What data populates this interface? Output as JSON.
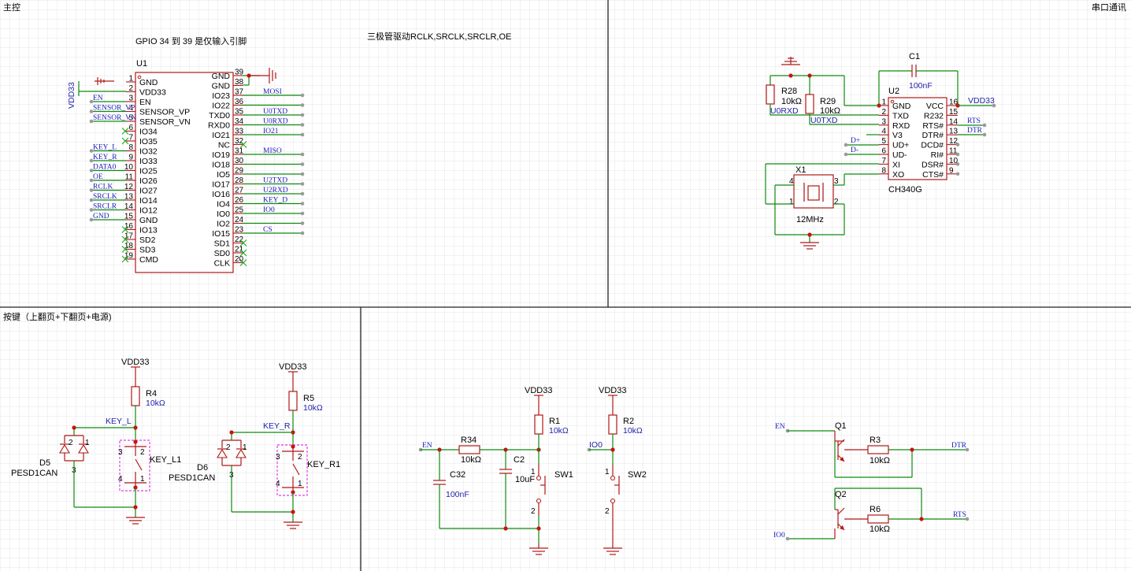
{
  "sections": {
    "main": "主控",
    "serial": "串口通讯",
    "keys": "按键（上翻页+下翻页+电源)"
  },
  "notes": {
    "gpio_note": "GPIO 34 到 39 是仅输入引脚",
    "transistor_note": "三极管驱动RCLK,SRCLK,SRCLR,OE"
  },
  "u1": {
    "ref": "U1",
    "power_label": "VDD33",
    "left_pins": [
      {
        "num": "1",
        "name": "GND",
        "net": ""
      },
      {
        "num": "2",
        "name": "VDD33",
        "net": ""
      },
      {
        "num": "3",
        "name": "EN",
        "net": "EN"
      },
      {
        "num": "4",
        "name": "SENSOR_VP",
        "net": "SENSOR_VP"
      },
      {
        "num": "5",
        "name": "SENSOR_VN",
        "net": "SENSOR_VN"
      },
      {
        "num": "6",
        "name": "IO34",
        "net": ""
      },
      {
        "num": "7",
        "name": "IO35",
        "net": ""
      },
      {
        "num": "8",
        "name": "IO32",
        "net": "KEY_L"
      },
      {
        "num": "9",
        "name": "IO33",
        "net": "KEY_R"
      },
      {
        "num": "10",
        "name": "IO25",
        "net": "DATA0"
      },
      {
        "num": "11",
        "name": "IO26",
        "net": "OE"
      },
      {
        "num": "12",
        "name": "IO27",
        "net": "RCLK"
      },
      {
        "num": "13",
        "name": "IO14",
        "net": "SRCLK"
      },
      {
        "num": "14",
        "name": "IO12",
        "net": "SRCLR"
      },
      {
        "num": "15",
        "name": "GND",
        "net": "GND"
      },
      {
        "num": "16",
        "name": "IO13",
        "net": ""
      },
      {
        "num": "17",
        "name": "SD2",
        "net": ""
      },
      {
        "num": "18",
        "name": "SD3",
        "net": ""
      },
      {
        "num": "19",
        "name": "CMD",
        "net": ""
      }
    ],
    "right_pins": [
      {
        "num": "39",
        "name": "GND",
        "net": ""
      },
      {
        "num": "38",
        "name": "GND",
        "net": ""
      },
      {
        "num": "37",
        "name": "IO23",
        "net": "MOSI"
      },
      {
        "num": "36",
        "name": "IO22",
        "net": ""
      },
      {
        "num": "35",
        "name": "TXD0",
        "net": "U0TXD"
      },
      {
        "num": "34",
        "name": "RXD0",
        "net": "U0RXD"
      },
      {
        "num": "33",
        "name": "IO21",
        "net": "IO21"
      },
      {
        "num": "32",
        "name": "NC",
        "net": ""
      },
      {
        "num": "31",
        "name": "IO19",
        "net": "MISO"
      },
      {
        "num": "30",
        "name": "IO18",
        "net": ""
      },
      {
        "num": "29",
        "name": "IO5",
        "net": ""
      },
      {
        "num": "28",
        "name": "IO17",
        "net": "U2TXD"
      },
      {
        "num": "27",
        "name": "IO16",
        "net": "U2RXD"
      },
      {
        "num": "26",
        "name": "IO4",
        "net": "KEY_D"
      },
      {
        "num": "25",
        "name": "IO0",
        "net": "IO0"
      },
      {
        "num": "24",
        "name": "IO2",
        "net": ""
      },
      {
        "num": "23",
        "name": "IO15",
        "net": "CS"
      },
      {
        "num": "22",
        "name": "SD1",
        "net": ""
      },
      {
        "num": "21",
        "name": "SD0",
        "net": ""
      },
      {
        "num": "20",
        "name": "CLK",
        "net": ""
      }
    ]
  },
  "u2": {
    "ref": "U2",
    "part": "CH340G",
    "left_pins": [
      {
        "num": "1",
        "name": "GND"
      },
      {
        "num": "2",
        "name": "TXD"
      },
      {
        "num": "3",
        "name": "RXD"
      },
      {
        "num": "4",
        "name": "V3"
      },
      {
        "num": "5",
        "name": "UD+"
      },
      {
        "num": "6",
        "name": "UD-"
      },
      {
        "num": "7",
        "name": "XI"
      },
      {
        "num": "8",
        "name": "XO"
      }
    ],
    "right_pins": [
      {
        "num": "16",
        "name": "VCC"
      },
      {
        "num": "15",
        "name": "R232"
      },
      {
        "num": "14",
        "name": "RTS#"
      },
      {
        "num": "13",
        "name": "DTR#"
      },
      {
        "num": "12",
        "name": "DCD#"
      },
      {
        "num": "11",
        "name": "RI#"
      },
      {
        "num": "10",
        "name": "DSR#"
      },
      {
        "num": "9",
        "name": "CTS#"
      }
    ],
    "nets": {
      "vdd": "VDD33",
      "rts": "RTS",
      "dtr": "DTR",
      "dp": "D+",
      "dm": "D-"
    }
  },
  "serial_parts": {
    "c1": {
      "ref": "C1",
      "value": "100nF"
    },
    "r28": {
      "ref": "R28",
      "value": "10kΩ",
      "net": "U0RXD"
    },
    "r29": {
      "ref": "R29",
      "value": "10kΩ",
      "net": "U0TXD"
    },
    "x1": {
      "ref": "X1",
      "value": "12MHz",
      "pins": [
        "4",
        "3",
        "1",
        "2"
      ]
    }
  },
  "keys_section": {
    "left": {
      "vdd": "VDD33",
      "r_ref": "R4",
      "r_val": "10kΩ",
      "net": "KEY_L",
      "d_ref": "D5",
      "d_part": "PESD1CAN",
      "sw": "KEY_L1"
    },
    "right": {
      "vdd": "VDD33",
      "r_ref": "R5",
      "r_val": "10kΩ",
      "net": "KEY_R",
      "d_ref": "D6",
      "d_part": "PESD1CAN",
      "sw": "KEY_R1"
    }
  },
  "reset_section": {
    "en_net": "EN",
    "r34": {
      "ref": "R34",
      "value": "10kΩ"
    },
    "c32": {
      "ref": "C32",
      "value": "100nF"
    },
    "c2": {
      "ref": "C2",
      "value": "10uF"
    },
    "r1": {
      "ref": "R1",
      "value": "10kΩ",
      "vdd": "VDD33"
    },
    "sw1": "SW1",
    "io0_net": "IO0",
    "r2": {
      "ref": "R2",
      "value": "10kΩ",
      "vdd": "VDD33"
    },
    "sw2": "SW2"
  },
  "auto_section": {
    "en_net": "EN",
    "io0_net": "IO0",
    "q1": "Q1",
    "q2": "Q2",
    "r3": {
      "ref": "R3",
      "value": "10kΩ"
    },
    "r6": {
      "ref": "R6",
      "value": "10kΩ"
    },
    "dtr_net": "DTR",
    "rts_net": "RTS"
  }
}
